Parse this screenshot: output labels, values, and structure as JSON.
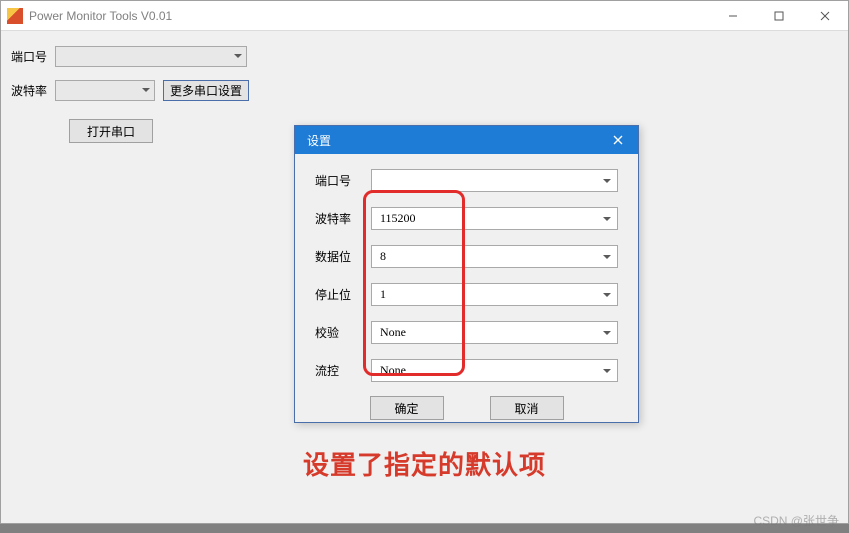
{
  "main_window": {
    "title": "Power Monitor Tools V0.01",
    "port_label": "端口号",
    "baud_label": "波特率",
    "more_serial_btn": "更多串口设置",
    "open_serial_btn": "打开串口",
    "port_value": "",
    "baud_value": ""
  },
  "dialog": {
    "title": "设置",
    "fields": {
      "port": {
        "label": "端口号",
        "value": ""
      },
      "baud": {
        "label": "波特率",
        "value": "115200"
      },
      "databits": {
        "label": "数据位",
        "value": "8"
      },
      "stopbits": {
        "label": "停止位",
        "value": "1"
      },
      "parity": {
        "label": "校验",
        "value": "None"
      },
      "flowctrl": {
        "label": "流控",
        "value": "None"
      }
    },
    "ok_btn": "确定",
    "cancel_btn": "取消"
  },
  "annotation": "设置了指定的默认项",
  "watermark": "CSDN @张世争"
}
